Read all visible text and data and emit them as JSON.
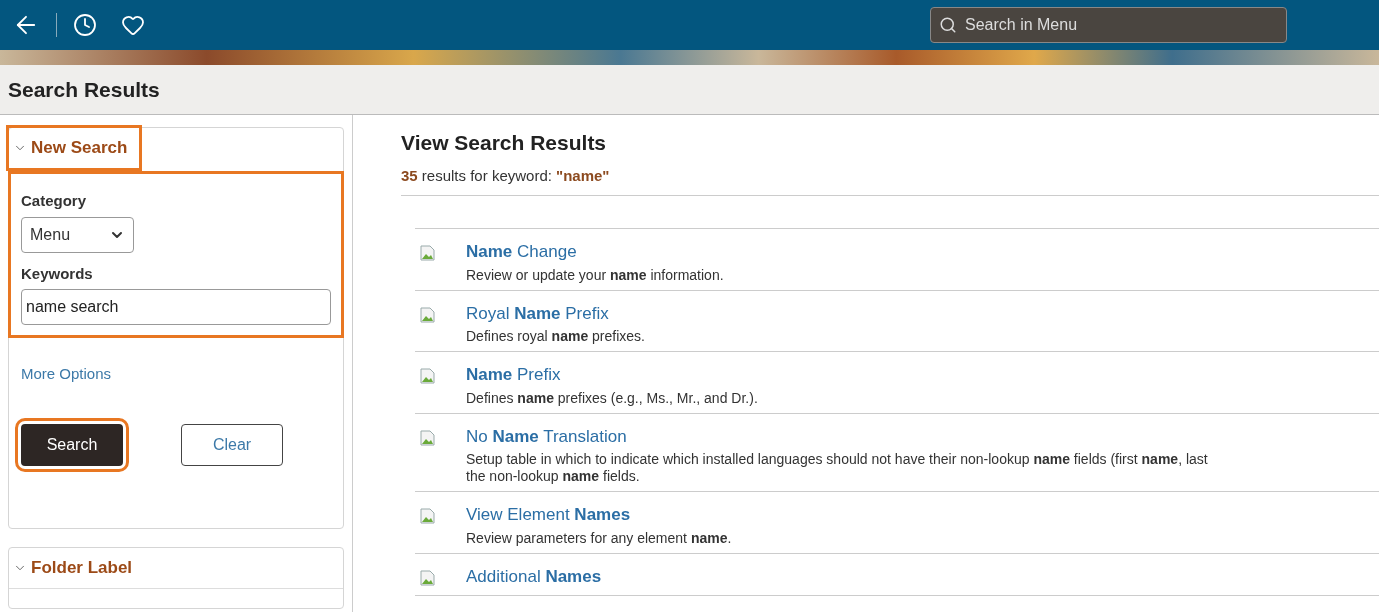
{
  "top_bar": {
    "search": {
      "placeholder": "Search in Menu"
    }
  },
  "page_title": "Search Results",
  "new_search": {
    "title": "New Search",
    "expanded": true,
    "highlighted": true,
    "form": {
      "highlighted": true,
      "category_label": "Category",
      "category_value": "Menu",
      "keywords_label": "Keywords",
      "keywords_value": "name search"
    },
    "more_options": "More Options",
    "buttons": [
      {
        "label": "Search",
        "kind": "primary",
        "highlighted": true
      },
      {
        "label": "Clear",
        "kind": "secondary",
        "highlighted": false
      }
    ]
  },
  "folder_label": {
    "title": "Folder Label",
    "expanded": true
  },
  "results": {
    "heading": "View Search Results",
    "count": "35",
    "summary": "results for keyword:",
    "keyword": "\"name\"",
    "items": [
      {
        "title": "**Name** Change",
        "desc": [
          "Review or update your **name** information."
        ]
      },
      {
        "title": "Royal **Name** Prefix",
        "desc": [
          "Defines royal **name** prefixes."
        ]
      },
      {
        "title": "**Name** Prefix",
        "desc": [
          "Defines **name** prefixes (e.g., Ms., Mr., and Dr.)."
        ]
      },
      {
        "title": "No **Name** Translation",
        "desc": [
          "Setup table in which to indicate which installed languages should not have their non-lookup **name** fields (first **name**, last",
          "the non-lookup **name** fields."
        ]
      },
      {
        "title": "View Element **Names**",
        "desc": [
          "Review parameters for any element **name**."
        ]
      },
      {
        "title": "Additional **Names**"
      }
    ]
  }
}
